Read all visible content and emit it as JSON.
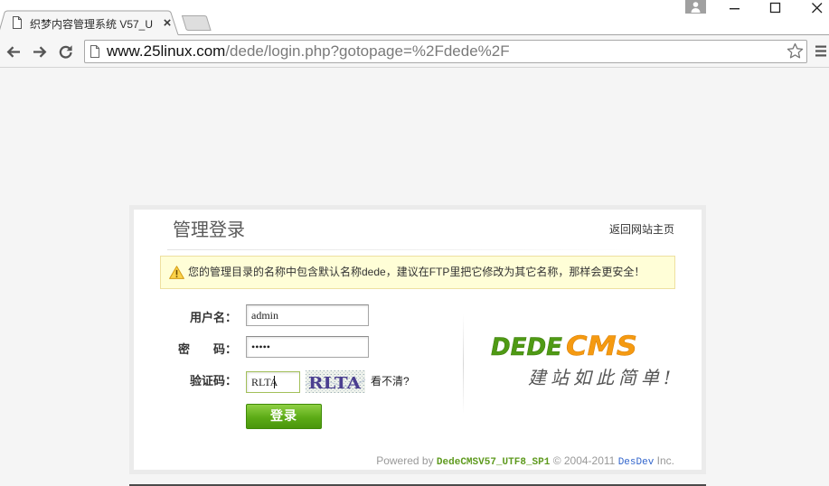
{
  "browser": {
    "tab": {
      "title": "织梦内容管理系统 V57_U",
      "close": "×"
    },
    "address": {
      "host": "www.25linux.com",
      "path": "/dede/login.php?gotopage=%2Fdede%2F"
    },
    "icons": {
      "tab_favicon": "page-icon",
      "new_tab": "new-tab-button",
      "profile": "user-icon",
      "minimize": "minimize-icon",
      "maximize": "maximize-icon",
      "close": "close-icon",
      "back": "back-arrow-icon",
      "forward": "forward-arrow-icon",
      "reload": "reload-icon",
      "address_page": "page-icon",
      "bookmark": "star-icon",
      "menu": "hamburger-menu-icon"
    }
  },
  "login": {
    "title": "管理登录",
    "home_link": "返回网站主页",
    "warning": {
      "icon": "warning-icon",
      "text": "您的管理目录的名称中包含默认名称dede，建议在FTP里把它修改为其它名称，那样会更安全！"
    },
    "username": {
      "label": "用户名：",
      "value": "admin"
    },
    "password": {
      "label": "密　　码：",
      "value": "•••••"
    },
    "captcha": {
      "label": "验证码：",
      "value": "RLTA",
      "image_text": "RLTA",
      "refresh_link": "看不清?"
    },
    "submit_label": "登录",
    "logo": {
      "left": "DEDE",
      "right": "CMS"
    },
    "slogan": "建站如此简单!",
    "footer": {
      "powered_by": "Powered by",
      "product": "DedeCMSV57_UTF8_SP1",
      "copyright": "© 2004-2011",
      "company": "DesDev",
      "suffix": "Inc."
    }
  },
  "colors": {
    "frame_bg": "#ffffff",
    "toolbar_bg": "#f6f6f6",
    "page_bg": "#f5f5f5",
    "warning_bg": "#fffed7",
    "focus_border": "#a3c05a",
    "button_green": "#5cab16",
    "logo_green": "#4f9a14",
    "logo_orange": "#f59a11",
    "product_green": "#5e9a1e",
    "link_blue": "#3366cc"
  }
}
